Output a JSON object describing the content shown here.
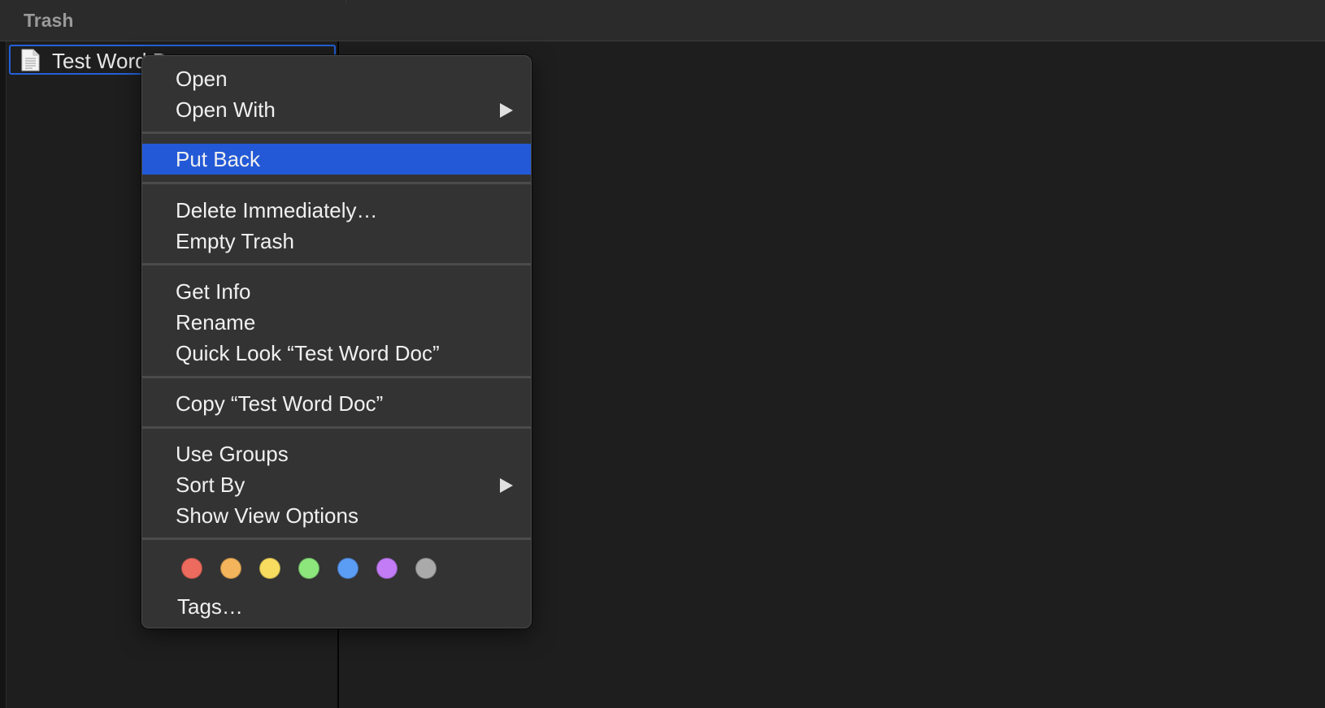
{
  "header": {
    "title": "Trash"
  },
  "file": {
    "name": "Test Word Doc",
    "icon": "document-icon"
  },
  "context_menu": {
    "open": "Open",
    "open_with": "Open With",
    "put_back": "Put Back",
    "delete_immediately": "Delete Immediately…",
    "empty_trash": "Empty Trash",
    "get_info": "Get Info",
    "rename": "Rename",
    "quick_look": "Quick Look “Test Word Doc”",
    "copy": "Copy “Test Word Doc”",
    "use_groups": "Use Groups",
    "sort_by": "Sort By",
    "show_view_options": "Show View Options",
    "tags": "Tags…",
    "highlighted_item": "Put Back"
  },
  "tag_colors": {
    "red": "#ec6a5e",
    "orange": "#f4b45b",
    "yellow": "#f7dc5f",
    "green": "#8ce67c",
    "blue": "#5b9cf5",
    "purple": "#c37cf5",
    "gray": "#aaaaaa"
  },
  "accent": "#2359d6"
}
